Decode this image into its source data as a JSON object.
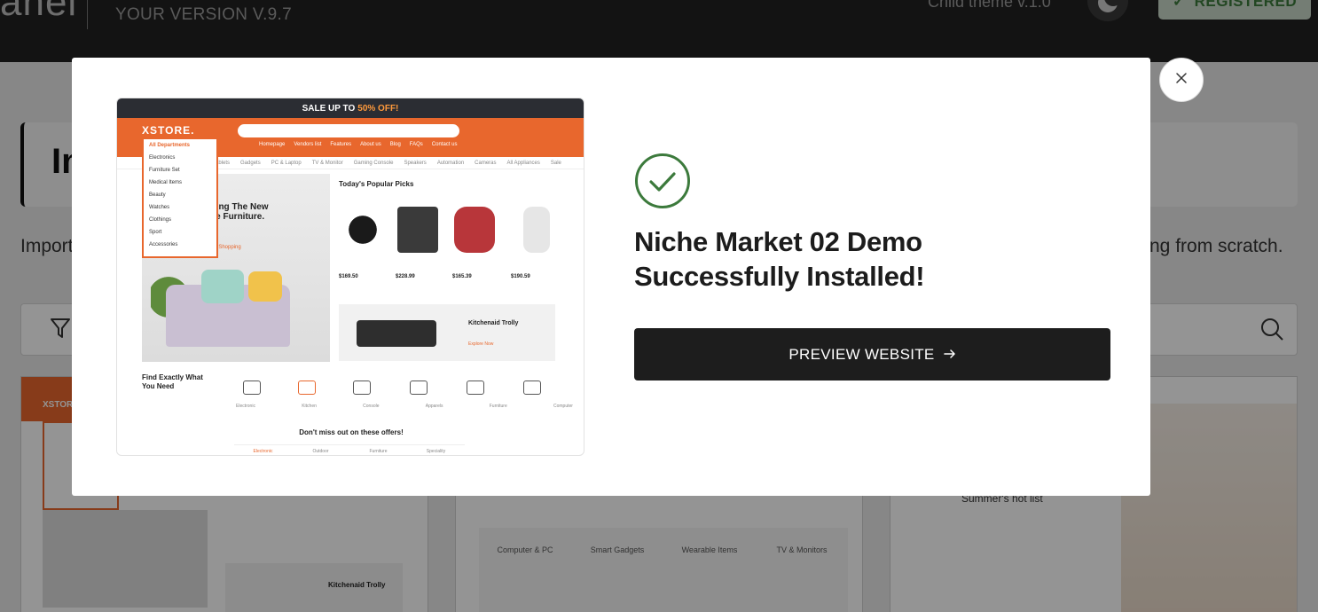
{
  "topbar": {
    "brand_fragment": "anel",
    "version": "YOUR VERSION V.9.7",
    "child_theme": "Child theme v.1.0",
    "registered_label": "REGISTERED",
    "registered_icon": "check-icon"
  },
  "page": {
    "title_fragment": "Im",
    "intro_left": "Import",
    "intro_right": "ng from scratch.",
    "filter_icon": "filter-icon",
    "search_icon": "search-icon"
  },
  "modal": {
    "success_icon": "check-circle-icon",
    "title_line1": "Niche Market 02 Demo",
    "title_line2": "Successfully Installed!",
    "preview_button_label": "PREVIEW WEBSITE",
    "preview_button_icon": "arrow-right-icon",
    "close_icon": "close-icon",
    "colors": {
      "accent": "#e8672d",
      "success": "#3c7a3c",
      "button": "#1d1d1d"
    }
  },
  "preview_image": {
    "promo_text": "SALE UP TO",
    "promo_highlight": "50% OFF!",
    "logo": "XSTORE.",
    "menu": [
      "Homepage",
      "Vendors list",
      "Features",
      "About us",
      "Blog",
      "FAQs",
      "Contact us"
    ],
    "subnav": [
      "Tablets",
      "Gadgets",
      "PC & Laptop",
      "TV & Monitor",
      "Gaming Console",
      "Speakers",
      "Automation",
      "Cameras",
      "All Appliances",
      "Sale"
    ],
    "departments_title": "All Departments",
    "departments": [
      "Electronics",
      "Furniture Set",
      "Medical Items",
      "Beauty",
      "Watches",
      "Clothings",
      "Sport",
      "Accessories"
    ],
    "hero_title": "ucing The New ace Furniture.",
    "hero_link": "Start Shopping",
    "picks_title": "Today's Popular Picks",
    "prices": [
      "$169.50",
      "$228.99",
      "$165.39",
      "$190.59"
    ],
    "promo_box_title": "Kitchenaid Trolly",
    "promo_box_link": "Explore Now",
    "find_title": "Find Exactly What You Need",
    "categories": [
      "Electronic",
      "Kitchen",
      "Console",
      "Apparels",
      "Furniture",
      "Computer"
    ],
    "offers_title": "Don't miss out on these offers!",
    "offer_tabs": [
      "Electronic",
      "Outdoor",
      "Furniture",
      "Speciality"
    ]
  },
  "background_cards": {
    "card1_logo": "XSTORE",
    "card1_promo_title": "Kitchenaid Trolly",
    "card2_categories": [
      "Computer & PC",
      "Smart Gadgets",
      "Wearable Items",
      "TV & Monitors"
    ],
    "card3_headline": "Summer's hot list"
  }
}
